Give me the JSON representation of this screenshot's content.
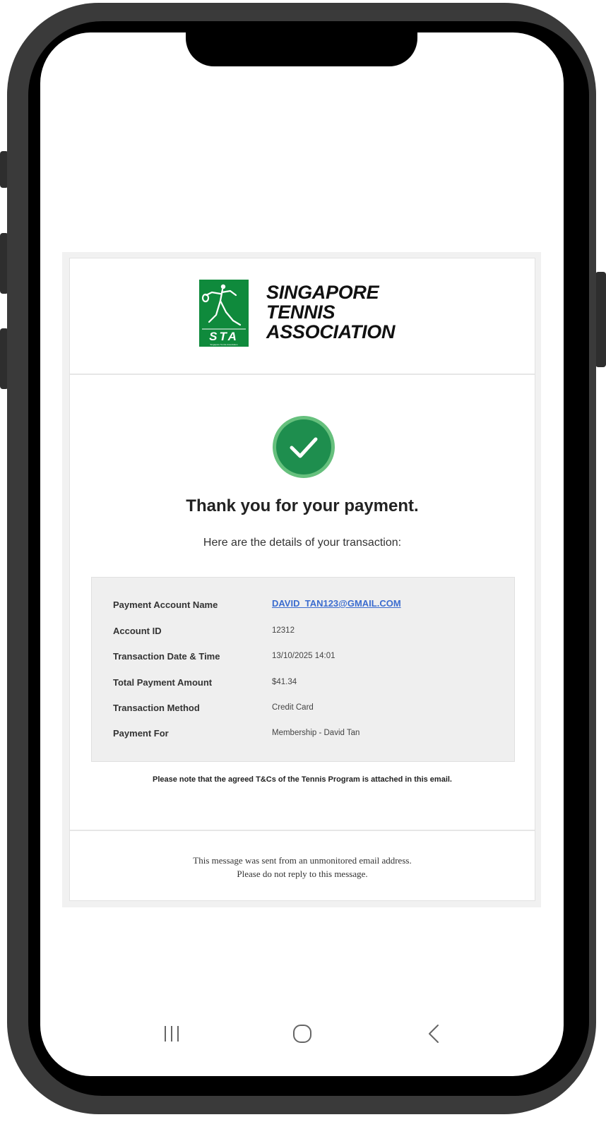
{
  "brand": {
    "logo_abbrev": "STA",
    "name_lines": [
      "SINGAPORE",
      "TENNIS",
      "ASSOCIATION"
    ],
    "logo_green": "#0f8a3c"
  },
  "body": {
    "title": "Thank you for your payment.",
    "subtitle": "Here are the details of your transaction:",
    "success_color": "#1e8e4e"
  },
  "details": [
    {
      "label": "Payment Account Name",
      "value": "DAVID_TAN123@GMAIL.COM"
    },
    {
      "label": "Account ID",
      "value": "12312"
    },
    {
      "label": "Transaction Date & Time",
      "value": "13/10/2025 14:01"
    },
    {
      "label": "Total Payment Amount",
      "value": "$41.34"
    },
    {
      "label": "Transaction Method",
      "value": "Credit Card"
    },
    {
      "label": "Payment For",
      "value": "Membership - David Tan"
    }
  ],
  "note": "Please note that the agreed T&Cs of the Tennis Program is attached in this email.",
  "footer": {
    "line1": "This message was sent from an unmonitored email address.",
    "line2": "Please do not reply to this message."
  },
  "navbar": {
    "recents_icon": "recent-apps-icon",
    "home_icon": "home-icon",
    "back_icon": "back-icon"
  }
}
